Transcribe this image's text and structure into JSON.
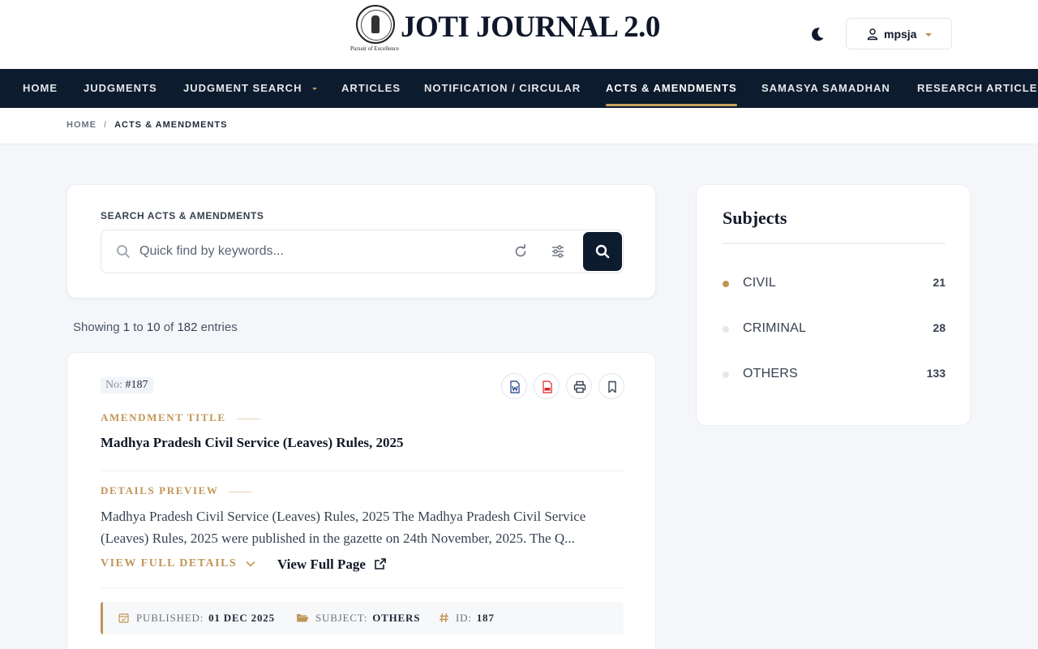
{
  "header": {
    "brand": "JOTI JOURNAL 2.0",
    "tagline": "Pursuit of Excellence",
    "user": "mpsja"
  },
  "nav": {
    "items": [
      {
        "label": "HOME"
      },
      {
        "label": "JUDGMENTS"
      },
      {
        "label": "JUDGMENT SEARCH"
      },
      {
        "label": "ARTICLES"
      },
      {
        "label": "NOTIFICATION / CIRCULAR"
      },
      {
        "label": "ACTS & AMENDMENTS",
        "active": true
      },
      {
        "label": "SAMASYA SAMADHAN"
      },
      {
        "label": "RESEARCH ARTICLES"
      }
    ]
  },
  "breadcrumb": {
    "home": "HOME",
    "separator": "/",
    "current": "ACTS & AMENDMENTS"
  },
  "search": {
    "label": "SEARCH ACTS & AMENDMENTS",
    "placeholder": "Quick find by keywords..."
  },
  "showing": {
    "prefix": "Showing",
    "from": "1",
    "to_word": "to",
    "to": "10",
    "of_word": "of",
    "total": "182",
    "suffix": "entries"
  },
  "entry": {
    "number_label": "No:",
    "number": "#187",
    "title_label": "AMENDMENT TITLE",
    "title": "Madhya Pradesh Civil Service (Leaves) Rules, 2025",
    "preview_label": "DETAILS PREVIEW",
    "preview": "Madhya Pradesh Civil Service (Leaves) Rules, 2025 The Madhya Pradesh Civil Service (Leaves) Rules, 2025 were published in the gazette on 24th November, 2025. The Q...",
    "view_full_details": "VIEW FULL DETAILS",
    "view_full_page": "View Full Page",
    "meta": {
      "published_label": "PUBLISHED:",
      "published": "01 DEC 2025",
      "subject_label": "SUBJECT:",
      "subject": "OTHERS",
      "id_label": "ID:",
      "id": "187"
    }
  },
  "subjects": {
    "title": "Subjects",
    "items": [
      {
        "name": "CIVIL",
        "count": "21",
        "active": true
      },
      {
        "name": "CRIMINAL",
        "count": "28"
      },
      {
        "name": "OTHERS",
        "count": "133"
      }
    ]
  },
  "colors": {
    "navy": "#0d1b2e",
    "gold": "#c09655",
    "background": "#f4f6f9"
  }
}
